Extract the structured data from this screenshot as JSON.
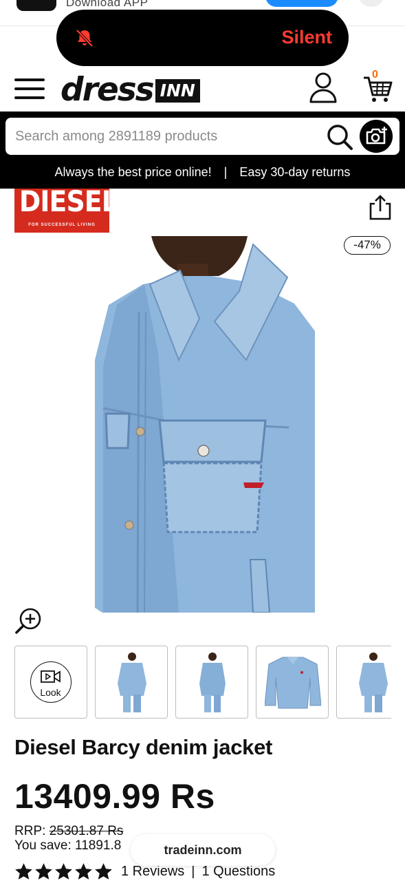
{
  "app_banner": {
    "label": "Download APP"
  },
  "notification": {
    "label": "Silent",
    "icon": "bell-slash-icon",
    "color": "#ff3b30"
  },
  "header": {
    "logo_main": "dress",
    "logo_suffix": "INN",
    "cart_count": "0",
    "icons": [
      "menu-icon",
      "user-icon",
      "cart-icon"
    ]
  },
  "search": {
    "placeholder": "Search among 2891189 products",
    "icons": [
      "search-icon",
      "camera-plus-icon"
    ]
  },
  "promo_bar": {
    "left": "Always the best price online!",
    "separator": "|",
    "right": "Easy 30-day returns"
  },
  "product": {
    "brand_logo": "DIESEL",
    "brand_tagline": "FOR SUCCESSFUL LIVING",
    "discount_badge": "-47%",
    "title": "Diesel Barcy denim jacket",
    "price": "13409.99 Rs",
    "rrp_label": "RRP:",
    "rrp_value": "25301.87 Rs",
    "save_label": "You save: 11891.8",
    "rating_stars": 5,
    "reviews": "1 Reviews",
    "rating_separator": "|",
    "questions": "1 Questions"
  },
  "gallery": {
    "look_label": "Look",
    "thumbnail_count": 5
  },
  "colors": {
    "accent": "#ff6a00",
    "brand_red": "#d52b1e",
    "denim": "#8fb6dc"
  },
  "browser": {
    "domain": "tradeinn.com"
  }
}
